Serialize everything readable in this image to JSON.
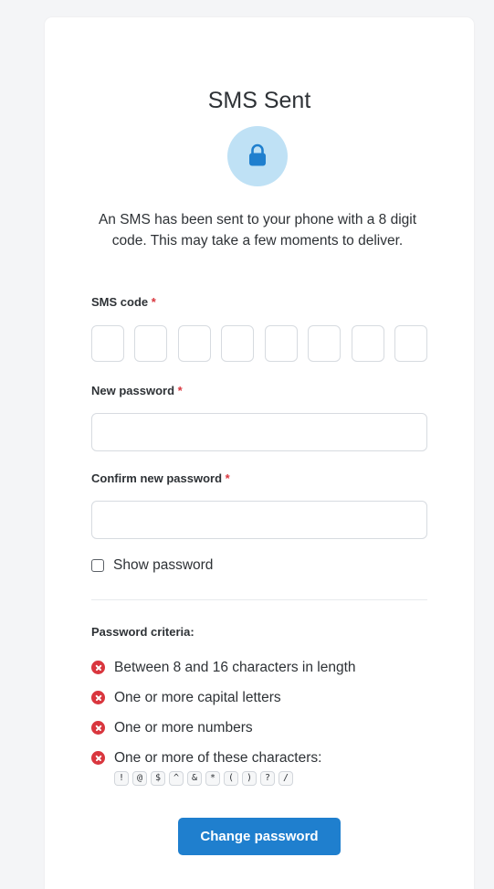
{
  "header": {
    "title": "SMS Sent",
    "icon": "lock-icon",
    "icon_color": "#1f7fce",
    "icon_bg": "#bfe1f5"
  },
  "intro": "An SMS has been sent to your phone with a 8 digit code. This may take a few moments to deliver.",
  "form": {
    "sms_code": {
      "label": "SMS code",
      "required_marker": "*",
      "digits": [
        "",
        "",
        "",
        "",
        "",
        "",
        "",
        ""
      ]
    },
    "new_password": {
      "label": "New password",
      "required_marker": "*",
      "value": ""
    },
    "confirm_password": {
      "label": "Confirm new password",
      "required_marker": "*",
      "value": ""
    },
    "show_password": {
      "label": "Show password",
      "checked": false
    }
  },
  "criteria": {
    "heading": "Password criteria:",
    "status_icon": "error-x-icon",
    "status_color": "#d9363e",
    "items": [
      "Between 8 and 16 characters in length",
      "One or more capital letters",
      "One or more numbers",
      "One or more of these characters:"
    ],
    "special_chars": [
      "!",
      "@",
      "$",
      "^",
      "&",
      "*",
      "(",
      ")",
      "?",
      "/"
    ]
  },
  "submit": {
    "label": "Change password",
    "color": "#1f7fce"
  }
}
